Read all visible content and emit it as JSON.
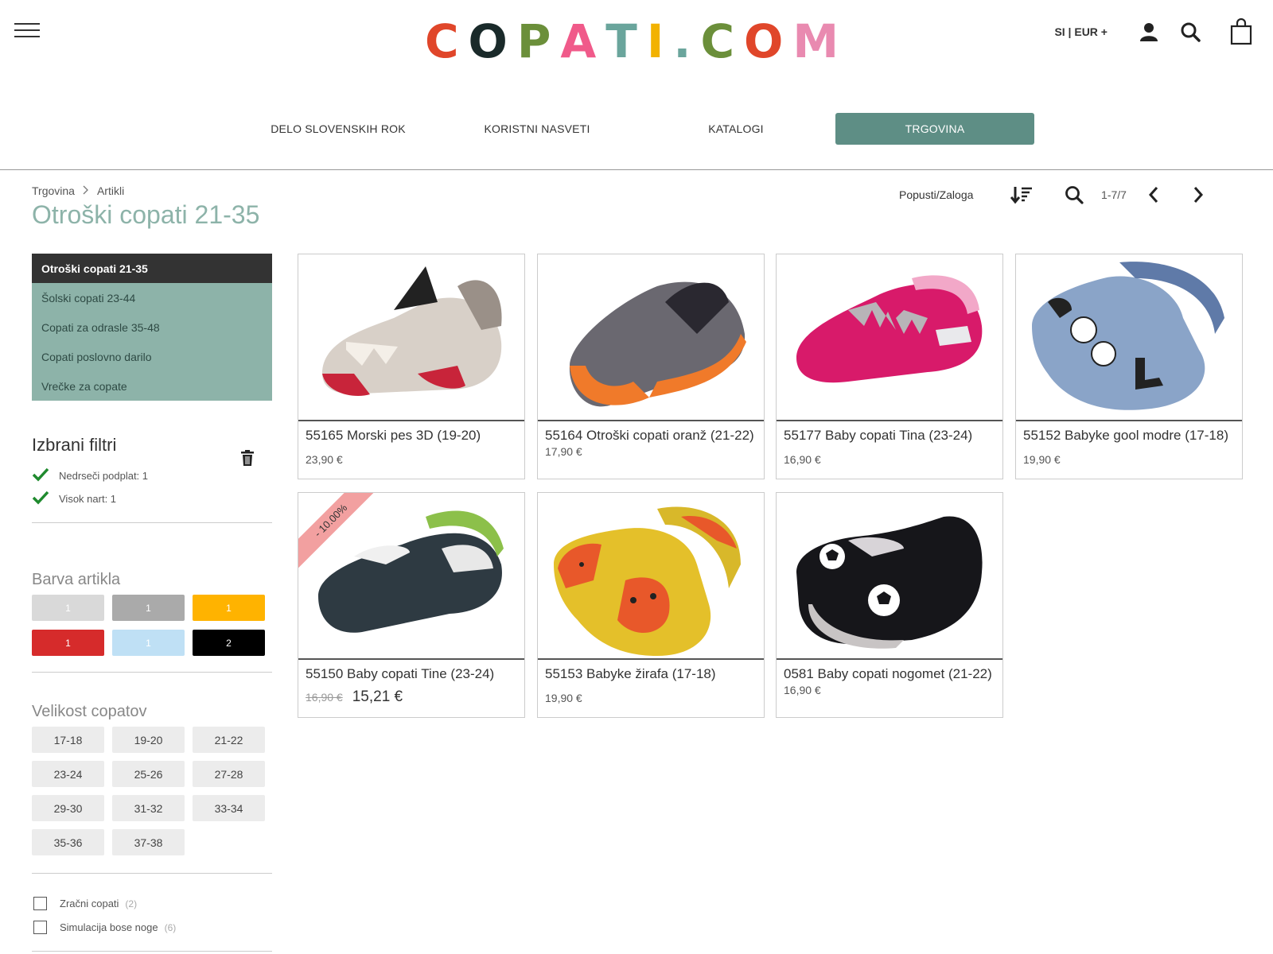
{
  "header": {
    "logo_letters": [
      {
        "ch": "C",
        "color": "#e0462a"
      },
      {
        "ch": "O",
        "color": "#1a2a2a"
      },
      {
        "ch": "P",
        "color": "#6b8f3a"
      },
      {
        "ch": "A",
        "color": "#f05a8a"
      },
      {
        "ch": "T",
        "color": "#6aa59c"
      },
      {
        "ch": "I",
        "color": "#f2b200"
      },
      {
        "ch": ".",
        "color": "#6aa59c"
      },
      {
        "ch": "C",
        "color": "#6b8f3a"
      },
      {
        "ch": "O",
        "color": "#e0462a"
      },
      {
        "ch": "M",
        "color": "#e98ab0"
      }
    ],
    "lang_currency": "SI | EUR +",
    "icons": [
      "menu-icon",
      "user-icon",
      "search-icon",
      "shopping-bag-icon"
    ]
  },
  "nav": {
    "items": [
      {
        "label": "DELO SLOVENSKIH ROK"
      },
      {
        "label": "KORISTNI NASVETI"
      },
      {
        "label": "KATALOGI"
      },
      {
        "label": "TRGOVINA"
      }
    ],
    "active_color": "#5e8e85"
  },
  "breadcrumb": {
    "items": [
      "Trgovina",
      "Artikli"
    ]
  },
  "page_title": "Otroški copati 21-35",
  "toolbar": {
    "sort_label": "Popusti/Zaloga",
    "pager": "1-7/7"
  },
  "categories": [
    {
      "label": "Otroški copati 21-35"
    },
    {
      "label": "Šolski copati 23-44"
    },
    {
      "label": "Copati za odrasle 35-48"
    },
    {
      "label": "Copati poslovno darilo"
    },
    {
      "label": "Vrečke za copate"
    }
  ],
  "selected_filters": {
    "title": "Izbrani filtri",
    "items": [
      {
        "label": "Nedrseči podplat: 1"
      },
      {
        "label": "Visok nart: 1"
      }
    ]
  },
  "color_filter": {
    "title": "Barva artikla",
    "swatches": [
      {
        "color": "#d9d9d9",
        "count": "1"
      },
      {
        "color": "#aaaaaa",
        "count": "1"
      },
      {
        "color": "#ffb300",
        "count": "1"
      },
      {
        "color": "#d62b2b",
        "count": "1"
      },
      {
        "color": "#bfe0f5",
        "count": "1"
      },
      {
        "color": "#000000",
        "count": "2"
      }
    ]
  },
  "size_filter": {
    "title": "Velikost copatov",
    "sizes": [
      "17-18",
      "19-20",
      "21-22",
      "23-24",
      "25-26",
      "27-28",
      "29-30",
      "31-32",
      "33-34",
      "35-36",
      "37-38"
    ]
  },
  "checkbox_filters": [
    {
      "label": "Zračni copati",
      "count": "(2)"
    },
    {
      "label": "Simulacija bose noge",
      "count": "(6)"
    }
  ],
  "products": [
    {
      "name": "55165 Morski pes 3D (19-20)",
      "price": "23,90 €"
    },
    {
      "name": "55164 Otroški copati oranž (21-22)",
      "price": "17,90 €"
    },
    {
      "name": "55177 Baby copati Tina (23-24)",
      "price": "16,90 €"
    },
    {
      "name": "55152 Babyke gool modre (17-18)",
      "price": "19,90 €"
    },
    {
      "name": "55150 Baby copati Tine (23-24)",
      "old_price": "16,90 €",
      "new_price": "15,21 €",
      "badge": "- 10.00%"
    },
    {
      "name": "55153 Babyke žirafa (17-18)",
      "price": "19,90 €"
    },
    {
      "name": "0581 Baby copati nogomet (21-22)",
      "price": "16,90 €"
    }
  ]
}
